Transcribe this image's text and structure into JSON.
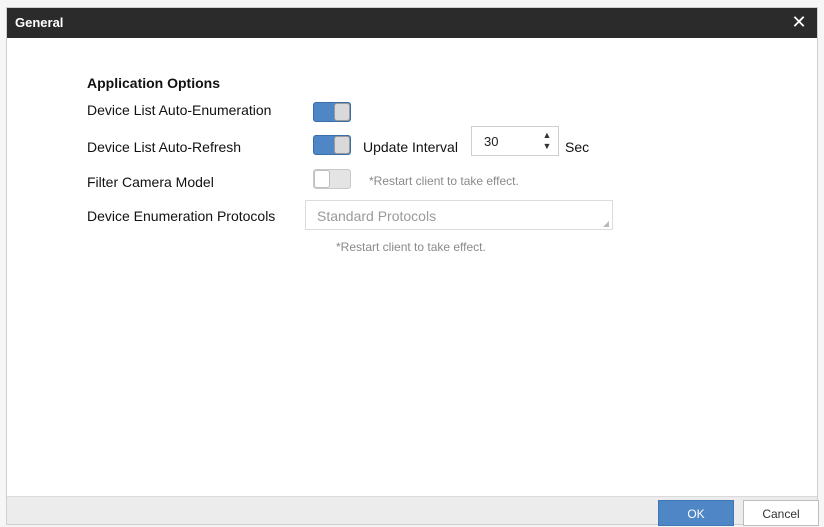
{
  "dialog": {
    "title": "General",
    "close_icon": "close-icon"
  },
  "options": {
    "section_title": "Application Options",
    "auto_enumeration": {
      "label": "Device List Auto-Enumeration",
      "enabled": true
    },
    "auto_refresh": {
      "label": "Device List Auto-Refresh",
      "enabled": true,
      "interval_label": "Update Interval",
      "interval_value": "30",
      "interval_unit": "Sec"
    },
    "filter_camera": {
      "label": "Filter Camera Model",
      "enabled": false,
      "hint": "*Restart client to take effect."
    },
    "enum_protocols": {
      "label": "Device Enumeration Protocols",
      "value": "Standard Protocols",
      "hint": "*Restart client to take effect."
    }
  },
  "footer": {
    "ok_label": "OK",
    "cancel_label": "Cancel"
  },
  "colors": {
    "accent": "#4f86c6",
    "titlebar": "#2b2b2b"
  }
}
